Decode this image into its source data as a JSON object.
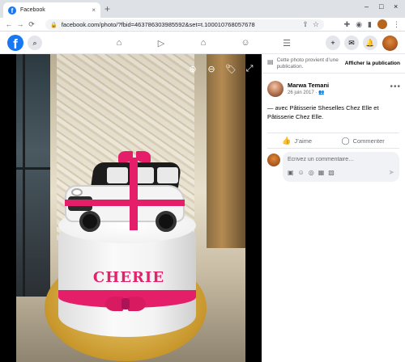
{
  "browser": {
    "tab_title": "Facebook",
    "tab_close": "×",
    "new_tab": "+",
    "window_controls": [
      "–",
      "□",
      "×"
    ],
    "url": "facebook.com/photo/?fbid=463786303985592&set=t.100010768057678",
    "nav": [
      "←",
      "→",
      "⟳"
    ]
  },
  "facebook": {
    "logo_letter": "f",
    "search_icon": "⌕",
    "nav_icons": [
      "⌂",
      "▷",
      "⌂",
      "☺",
      "☰"
    ],
    "header_buttons": [
      "+",
      "✉",
      "🔔"
    ]
  },
  "viewer": {
    "cake_text": "CHERIE",
    "tools": [
      "⊕",
      "⊖",
      "🏷",
      "⤢"
    ]
  },
  "panel": {
    "info_text": "Cette photo provient d’une publication.",
    "info_link": "Afficher la publication",
    "author": "Marwa Temani",
    "date": "26 juin 2017 · ",
    "caption": "— avec Pâtisserie Sheselles Chez Elle et Pâtisserie Chez Elle.",
    "like_label": "J’aime",
    "comment_label": "Commenter",
    "comment_placeholder": "Écrivez un commentaire…"
  },
  "colors": {
    "facebook_blue": "#1877f2",
    "cake_pink": "#e0246b"
  }
}
